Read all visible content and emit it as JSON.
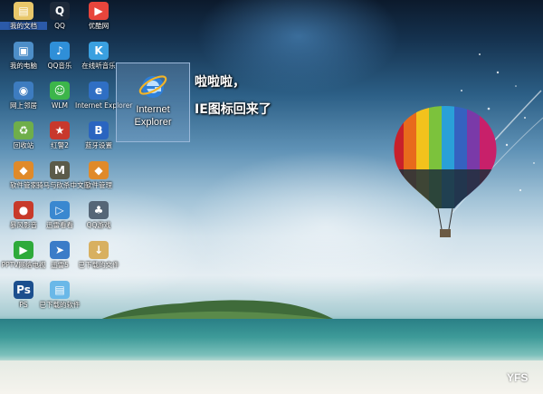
{
  "desktop_icons": [
    {
      "id": "wdwd",
      "label": "我的文档",
      "icon": "folder-documents-icon",
      "color": "#e8c76a",
      "selected": true
    },
    {
      "id": "qq",
      "label": "QQ",
      "icon": "penguin-icon",
      "color": "#1e2a3a"
    },
    {
      "id": "youku",
      "label": "优酷网",
      "icon": "play-icon",
      "color": "#e8453c"
    },
    {
      "id": "pc",
      "label": "我的电脑",
      "icon": "computer-icon",
      "color": "#4d8ec8"
    },
    {
      "id": "qqmusic",
      "label": "QQ音乐",
      "icon": "music-icon",
      "color": "#2f8fd8"
    },
    {
      "id": "kuwo",
      "label": "在线听音乐",
      "icon": "k-icon",
      "color": "#3aa0e0"
    },
    {
      "id": "network",
      "label": "网上邻居",
      "icon": "network-icon",
      "color": "#3d7cc0"
    },
    {
      "id": "wlm",
      "label": "WLM",
      "icon": "messenger-icon",
      "color": "#3cb54a"
    },
    {
      "id": "ie_small",
      "label": "Internet Explorer",
      "icon": "internet-explorer-icon",
      "color": "#2f6fc4"
    },
    {
      "id": "recycle",
      "label": "回收站",
      "icon": "recycle-bin-icon",
      "color": "#6fae4a"
    },
    {
      "id": "hongjing2",
      "label": "红警2",
      "icon": "star-icon",
      "color": "#c8382c"
    },
    {
      "id": "bluetooth",
      "label": "蓝牙设置",
      "icon": "bluetooth-icon",
      "color": "#2a65c0"
    },
    {
      "id": "soft1",
      "label": "软件管家",
      "icon": "app-icon",
      "color": "#e08a2a"
    },
    {
      "id": "mw",
      "label": "骑马与砍杀中文版",
      "icon": "mw-icon",
      "color": "#5b5b4a"
    },
    {
      "id": "soft2",
      "label": "软件管理",
      "icon": "app-icon",
      "color": "#e08a2a"
    },
    {
      "id": "storm",
      "label": "暴风影音",
      "icon": "storm-icon",
      "color": "#c83a2a"
    },
    {
      "id": "xl",
      "label": "迅雷看看",
      "icon": "xl-icon",
      "color": "#3a88d0"
    },
    {
      "id": "qqgame",
      "label": "QQ游戏",
      "icon": "game-icon",
      "color": "#556677"
    },
    {
      "id": "pplive",
      "label": "PPTV网络电视",
      "icon": "play-icon",
      "color": "#2eaa3a"
    },
    {
      "id": "xunlei",
      "label": "迅雷5",
      "icon": "xunlei-icon",
      "color": "#3b7cc8"
    },
    {
      "id": "downloads",
      "label": "已下载的文件",
      "icon": "download-icon",
      "color": "#d8b060"
    },
    {
      "id": "ps",
      "label": "PS",
      "icon": "ps-icon",
      "color": "#1c4f8e"
    },
    {
      "id": "downfolder",
      "label": "已下载的软件",
      "icon": "folder-icon",
      "color": "#6ab8e8"
    }
  ],
  "selected_icon": {
    "label_line1": "Internet",
    "label_line2": "Explorer",
    "icon": "internet-explorer-icon"
  },
  "caption": {
    "line1": "啦啦啦，",
    "line2": "IE图标回来了"
  },
  "watermark": "YFS"
}
